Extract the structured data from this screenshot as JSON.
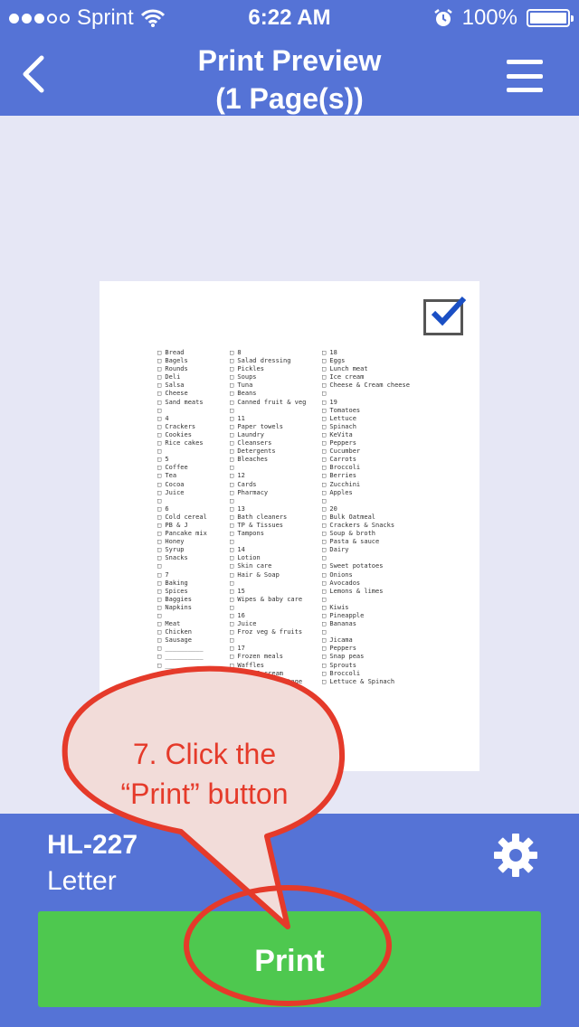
{
  "status_bar": {
    "carrier": "Sprint",
    "time": "6:22 AM",
    "battery": "100%",
    "battery_level": 1.0
  },
  "nav": {
    "title_line1": "Print Preview",
    "title_line2": "(1 Page(s))",
    "back_icon": "chevron-left-icon",
    "menu_icon": "hamburger-menu-icon"
  },
  "preview": {
    "col1": [
      "Bread",
      "Bagels",
      "Rounds",
      "Deli",
      "Salsa",
      "Cheese",
      "Sand meats",
      "",
      "4",
      "Crackers",
      "Cookies",
      "Rice cakes",
      "",
      "5",
      "Coffee",
      "Tea",
      "Cocoa",
      "Juice",
      "",
      "6",
      "Cold cereal",
      "PB & J",
      "Pancake mix",
      "Honey",
      "Syrup",
      "Snacks",
      "",
      "7",
      "Baking",
      "Spices",
      "Baggies",
      "Napkins",
      "",
      "Meat",
      "Chicken",
      "Sausage",
      "__________",
      "__________",
      "__________",
      "__________"
    ],
    "col2": [
      "8",
      "Salad dressing",
      "Pickles",
      "Soups",
      "Tuna",
      "Beans",
      "Canned fruit & veg",
      "",
      "11",
      "Paper towels",
      "Laundry",
      "Cleansers",
      "Detergents",
      "Bleaches",
      "",
      "12",
      "Cards",
      "Pharmacy",
      "",
      "13",
      "Bath cleaners",
      "TP & Tissues",
      "Tampons",
      "",
      "14",
      "Lotion",
      "Skin care",
      "Hair & Soap",
      "",
      "15",
      "Wipes & baby care",
      "",
      "16",
      "Juice",
      "Froz veg & fruits",
      "",
      "17",
      "Frozen meals",
      "Waffles",
      "Milk & cream",
      "Ricotta & Cottage"
    ],
    "col3": [
      "18",
      "Eggs",
      "Lunch meat",
      "Ice cream",
      "Cheese & Cream cheese",
      "",
      "19",
      "Tomatoes",
      "Lettuce",
      "Spinach",
      "KeVita",
      "Peppers",
      "Cucumber",
      "Carrots",
      "Broccoli",
      "Berries",
      "Zucchini",
      "Apples",
      "",
      "20",
      "Bulk Oatmeal",
      "Crackers & Snacks",
      "Soup & broth",
      "Pasta & sauce",
      "Dairy",
      "",
      "Sweet potatoes",
      "Onions",
      "Avocados",
      "Lemons & limes",
      "",
      "Kiwis",
      "Pineapple",
      "Bananas",
      "",
      "Jicama",
      "Peppers",
      "Snap peas",
      "Sprouts",
      "Broccoli",
      "Lettuce & Spinach"
    ]
  },
  "bottom": {
    "printer_name": "HL-227",
    "paper_size": "Letter",
    "settings_icon": "gear-icon",
    "print_label": "Print"
  },
  "callout": {
    "line1": "7. Click the",
    "line2": "“Print” button"
  },
  "colors": {
    "header_blue": "#5573d6",
    "preview_bg": "#e6e7f5",
    "print_green": "#4ec84f",
    "callout_red": "#e53a2a",
    "checkmark_blue": "#1a4fc4"
  }
}
